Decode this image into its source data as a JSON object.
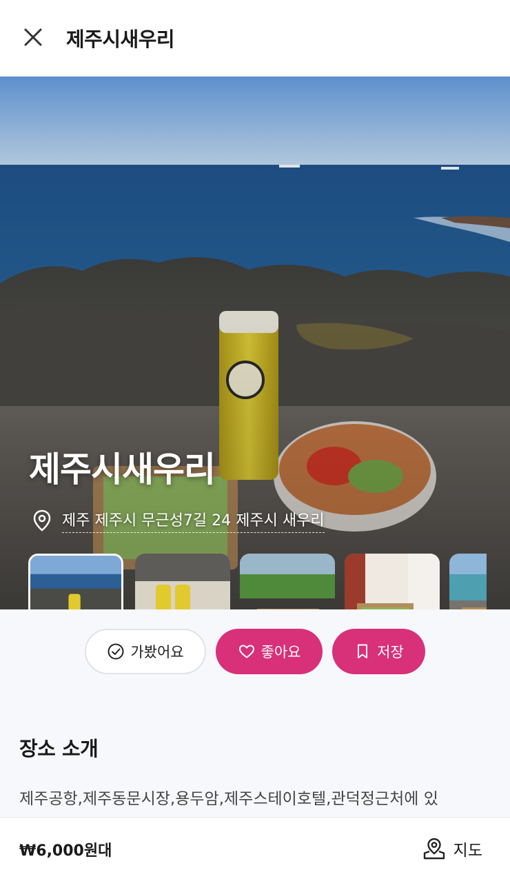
{
  "header": {
    "title": "제주시새우리",
    "close_icon": "close-icon"
  },
  "hero": {
    "title": "제주시새우리",
    "address": "제주 제주시 무근성7길 24 제주시 새우리",
    "address_icon": "map-pin-icon"
  },
  "gallery": {
    "thumbnails": [
      {
        "subject": "ocean-view-drinks",
        "active": true
      },
      {
        "subject": "beach-drinks-sandwiches"
      },
      {
        "subject": "greenery-sandwich-box"
      },
      {
        "subject": "shop-sandwich-box"
      },
      {
        "subject": "seaside-sandwich-box"
      }
    ]
  },
  "actions": {
    "visited_label": "가봤어요",
    "like_label": "좋아요",
    "save_label": "저장"
  },
  "intro": {
    "section_title": "장소 소개",
    "text": "제주공항,제주동문시장,용두암,제주스테이호텔,관덕정근처에 있"
  },
  "footer": {
    "price": "₩6,000원대",
    "map_label": "지도"
  },
  "colors": {
    "accent": "#d9307a",
    "background": "#f7f8fb"
  }
}
